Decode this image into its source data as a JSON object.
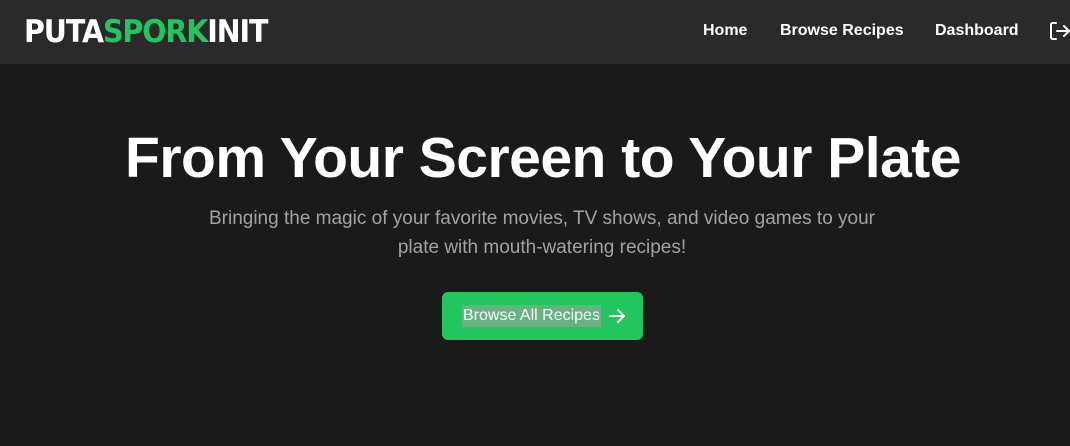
{
  "colors": {
    "background": "#1a1a1a",
    "navbar": "#2a2a2a",
    "accent": "#22c55e",
    "subtitle": "#a3a3a3"
  },
  "brand": {
    "part1": "PUTA",
    "part2": "SPORK",
    "part3": "INIT"
  },
  "nav": {
    "home": "Home",
    "browse": "Browse Recipes",
    "dashboard": "Dashboard",
    "logout_icon": "logout-icon"
  },
  "hero": {
    "title": "From Your Screen to Your Plate",
    "subtitle": "Bringing the magic of your favorite movies, TV shows, and video games to your plate with mouth-watering recipes!",
    "cta_label": "Browse All Recipes",
    "cta_icon": "arrow-right-icon"
  }
}
